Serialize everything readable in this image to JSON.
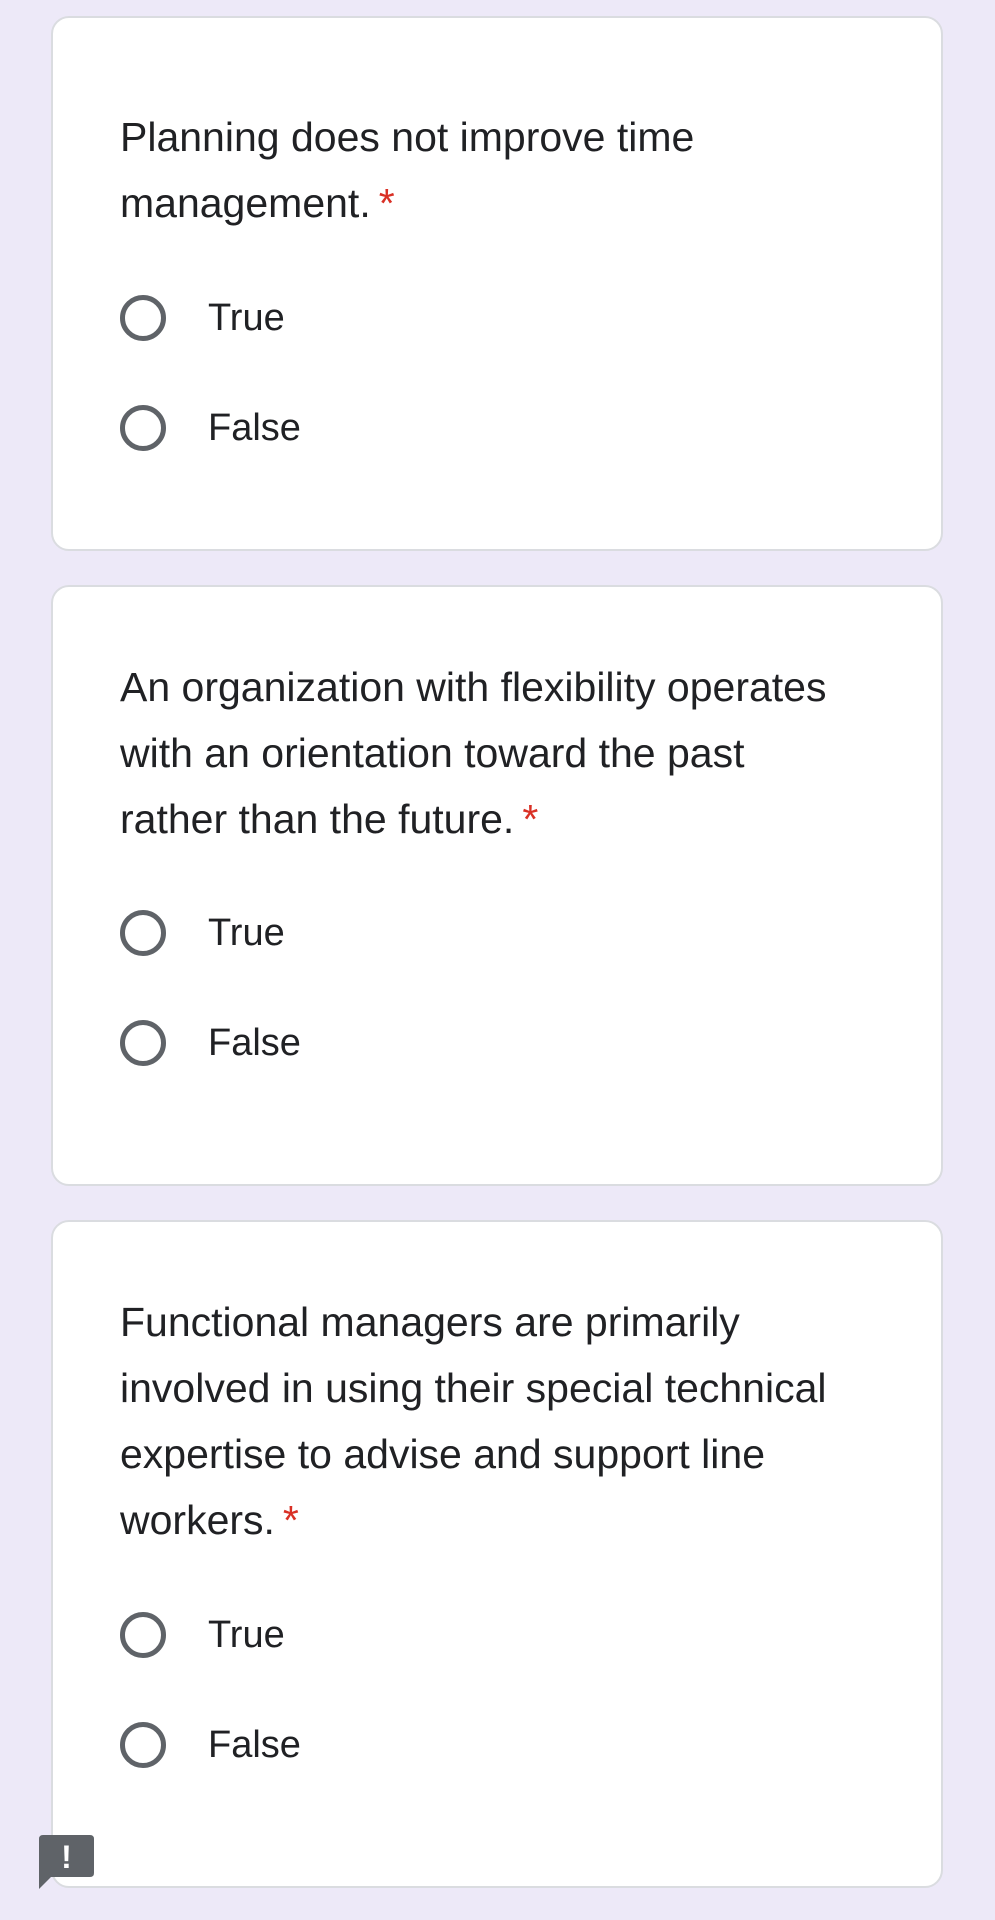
{
  "questions": [
    {
      "text": "Planning does not improve time management.",
      "required_mark": "*",
      "options": [
        {
          "label": "True",
          "selected": false
        },
        {
          "label": "False",
          "selected": false
        }
      ]
    },
    {
      "text": "An organization with flexibility operates with an orientation toward the past rather than the future.",
      "required_mark": "*",
      "options": [
        {
          "label": "True",
          "selected": false
        },
        {
          "label": "False",
          "selected": false
        }
      ]
    },
    {
      "text": "Functional managers are primarily involved in using their special technical expertise to advise and support line workers.",
      "required_mark": "*",
      "options": [
        {
          "label": "True",
          "selected": false
        },
        {
          "label": "False",
          "selected": false
        }
      ]
    }
  ],
  "report_button": {
    "icon": "exclamation-icon",
    "glyph": "!"
  },
  "colors": {
    "background": "#ede9f8",
    "card": "#ffffff",
    "required": "#d93025",
    "radio_border": "#5f6368",
    "text": "#202124"
  }
}
